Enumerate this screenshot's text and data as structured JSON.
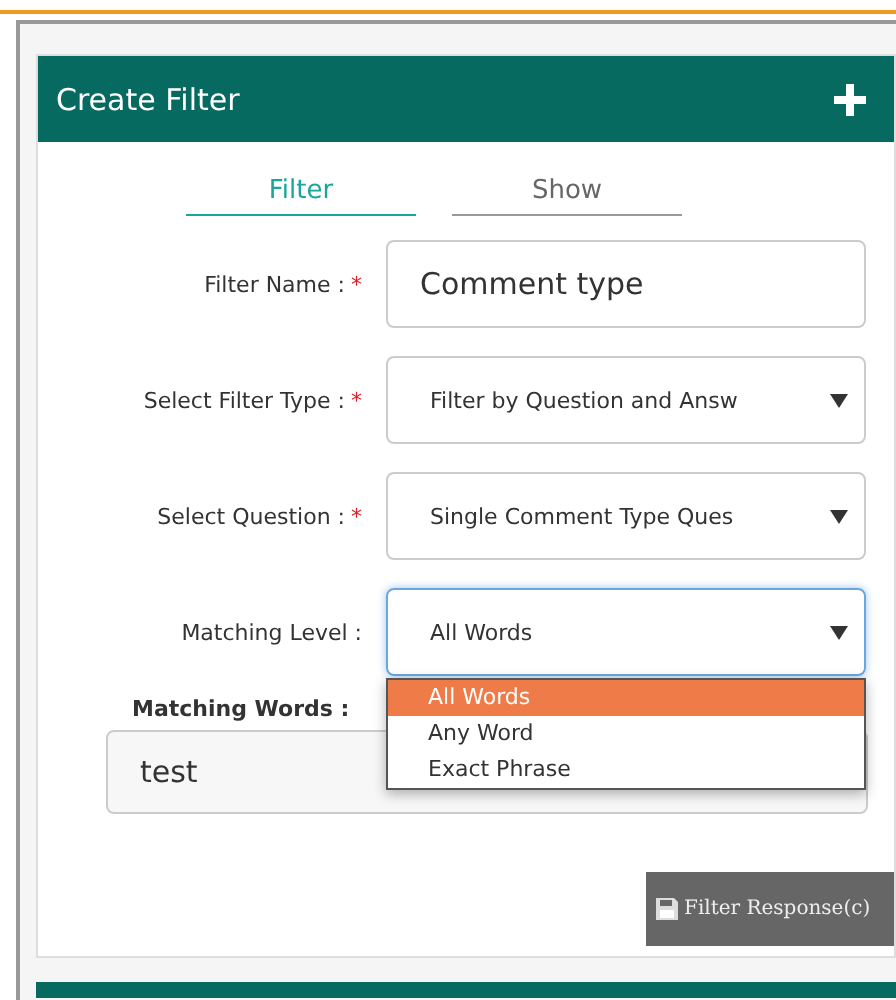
{
  "panel": {
    "title": "Create Filter"
  },
  "tabs": [
    {
      "label": "Filter",
      "selected": true
    },
    {
      "label": "Show",
      "selected": false
    }
  ],
  "fields": [
    {
      "label": "Filter Name :",
      "required_mark": "*",
      "kind": "text",
      "value": "Comment type"
    },
    {
      "label": "Select Filter Type :",
      "required_mark": "*",
      "kind": "select",
      "value": "Filter by Question and Answ",
      "open": false
    },
    {
      "label": "Select Question :",
      "required_mark": "*",
      "kind": "select",
      "value": "Single Comment Type Ques",
      "open": false
    },
    {
      "label": "Matching Level :",
      "kind": "select",
      "value": "All Words",
      "open": true
    }
  ],
  "dropdown_options": [
    {
      "label": "All Words",
      "selected": true
    },
    {
      "label": "Any Word",
      "selected": false
    },
    {
      "label": "Exact Phrase",
      "selected": false
    }
  ],
  "matching_words": {
    "label": "Matching Words :",
    "value": "test"
  },
  "submit_button": {
    "label": "Filter Response(c)"
  }
}
